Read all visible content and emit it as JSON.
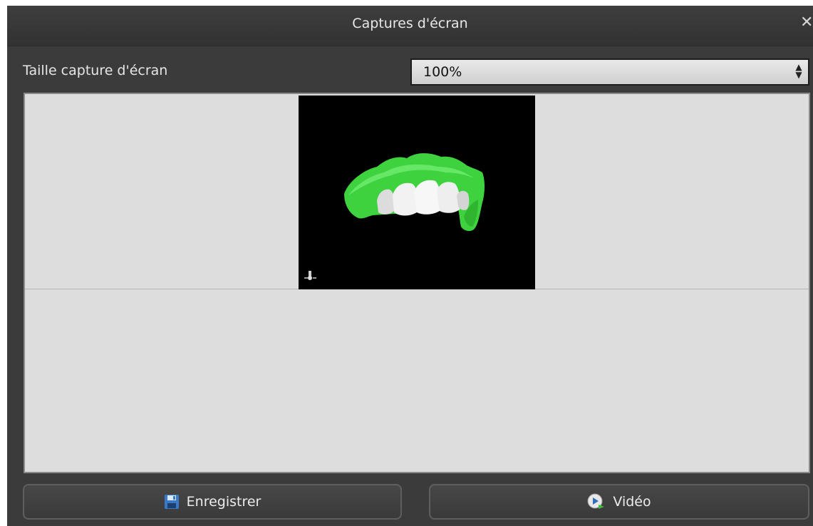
{
  "window": {
    "title": "Captures d'écran",
    "close_icon": "close-icon"
  },
  "settings": {
    "size_label": "Taille capture d'écran",
    "size_value": "100%"
  },
  "preview": {
    "thumbnails": [
      {
        "subject": "3d-dental-model",
        "colors": {
          "gums": "#3fd23f",
          "teeth": "#f2f2f2",
          "background": "#000000"
        }
      }
    ]
  },
  "buttons": {
    "save": {
      "label": "Enregistrer",
      "icon": "floppy-disk-icon"
    },
    "video": {
      "label": "Vidéo",
      "icon": "video-play-icon"
    }
  },
  "colors": {
    "window_bg": "#3b3b3b",
    "panel_bg": "#dddddd",
    "text": "#e6e6e6"
  }
}
